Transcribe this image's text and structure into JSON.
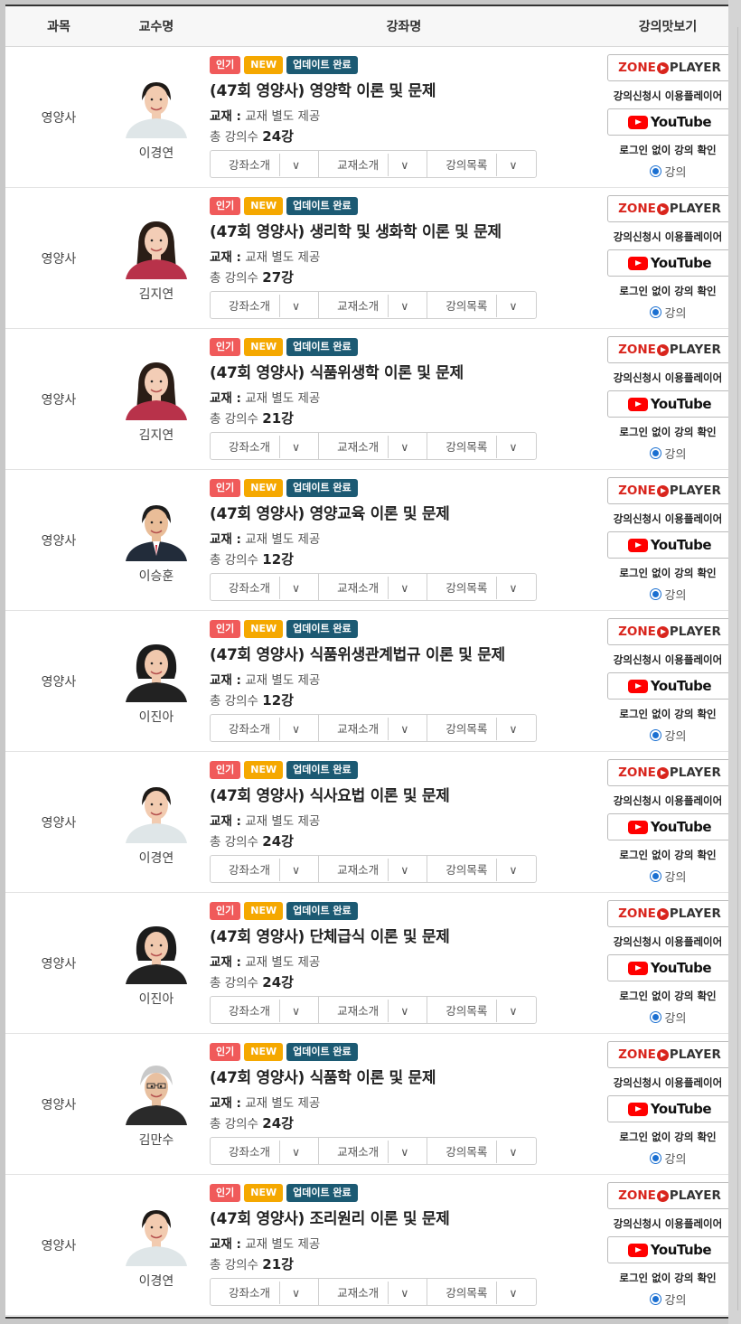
{
  "header": {
    "subject": "과목",
    "professor": "교수명",
    "course": "강좌명",
    "preview": "강의맛보기"
  },
  "labels": {
    "hot": "인기",
    "new": "NEW",
    "updated": "업데이트 완료",
    "textbook_label": "교재 :",
    "textbook_value": "교재 별도 제공",
    "count_prefix": "총 강의수",
    "count_suffix": "강",
    "btn_course_intro": "강좌소개",
    "btn_book_intro": "교재소개",
    "btn_lecture_list": "강의목록",
    "zone_a": "ZONE",
    "zone_b": "PLAYER",
    "caption_player": "강의신청시 이용플레이어",
    "youtube": "YouTube",
    "caption_nologin": "로그인 없이 강의 확인",
    "radio_label": "강의"
  },
  "colors": {
    "hot": "#f05a5a",
    "new": "#f5a800",
    "updated": "#1c5a73",
    "youtube_red": "#ff0000",
    "zone_red": "#d9251d",
    "radio_blue": "#1a6fd1"
  },
  "rows": [
    {
      "subject": "영양사",
      "professor": "이경연",
      "avatar": "lee-kyeongyeon",
      "title": "(47회 영양사) 영양학 이론 및 문제",
      "count": "24"
    },
    {
      "subject": "영양사",
      "professor": "김지연",
      "avatar": "kim-jiyeon",
      "title": "(47회 영양사) 생리학 및 생화학 이론 및 문제",
      "count": "27"
    },
    {
      "subject": "영양사",
      "professor": "김지연",
      "avatar": "kim-jiyeon",
      "title": "(47회 영양사) 식품위생학 이론 및 문제",
      "count": "21"
    },
    {
      "subject": "영양사",
      "professor": "이승훈",
      "avatar": "lee-seunghun",
      "title": "(47회 영양사) 영양교육 이론 및 문제",
      "count": "12"
    },
    {
      "subject": "영양사",
      "professor": "이진아",
      "avatar": "lee-jina",
      "title": "(47회 영양사) 식품위생관계법규 이론 및 문제",
      "count": "12"
    },
    {
      "subject": "영양사",
      "professor": "이경연",
      "avatar": "lee-kyeongyeon",
      "title": "(47회 영양사) 식사요법 이론 및 문제",
      "count": "24"
    },
    {
      "subject": "영양사",
      "professor": "이진아",
      "avatar": "lee-jina",
      "title": "(47회 영양사) 단체급식 이론 및 문제",
      "count": "24"
    },
    {
      "subject": "영양사",
      "professor": "김만수",
      "avatar": "kim-mansu",
      "title": "(47회 영양사) 식품학 이론 및 문제",
      "count": "24"
    },
    {
      "subject": "영양사",
      "professor": "이경연",
      "avatar": "lee-kyeongyeon",
      "title": "(47회 영양사) 조리원리 이론 및 문제",
      "count": "21"
    }
  ]
}
